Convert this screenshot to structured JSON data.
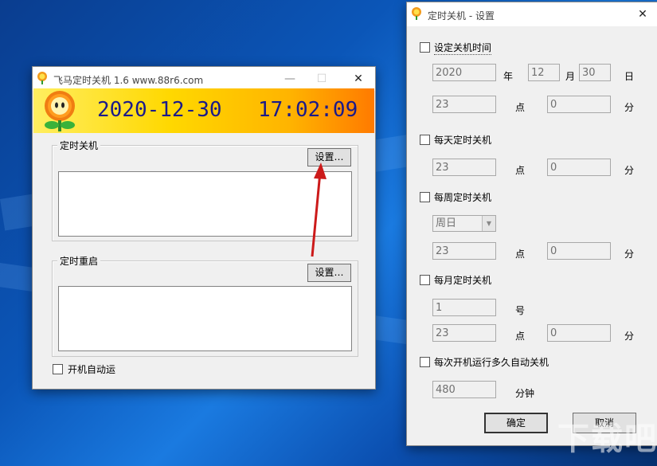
{
  "main_window": {
    "title": "飞马定时关机 1.6  www.88r6.com",
    "date": "2020-12-30",
    "time": "17:02:09",
    "shutdown_group_label": "定时关机",
    "restart_group_label": "定时重启",
    "settings_button_label": "设置…",
    "autostart_label": "开机自动运"
  },
  "settings_window": {
    "title": "定时关机 - 设置",
    "set_time_label": "设定关机时间",
    "year_value": "2020",
    "year_unit": "年",
    "month_value": "12",
    "month_unit": "月",
    "day_value": "30",
    "day_unit": "日",
    "hour_unit": "点",
    "minute_unit": "分",
    "set_time_hour": "23",
    "set_time_minute": "0",
    "daily_label": "每天定时关机",
    "daily_hour": "23",
    "daily_minute": "0",
    "weekly_label": "每周定时关机",
    "weekly_day": "周日",
    "weekly_hour": "23",
    "weekly_minute": "0",
    "monthly_label": "每月定时关机",
    "monthly_day": "1",
    "monthly_day_unit": "号",
    "monthly_hour": "23",
    "monthly_minute": "0",
    "after_boot_label": "每次开机运行多久自动关机",
    "after_boot_value": "480",
    "after_boot_unit": "分钟",
    "ok_label": "确定",
    "cancel_label": "取消"
  },
  "watermark": "下载吧",
  "colors": {
    "banner_yellow": "#ffd800",
    "banner_orange": "#ff7a00",
    "clock_text": "#1a1a8a",
    "arrow": "#cc1a1a"
  }
}
